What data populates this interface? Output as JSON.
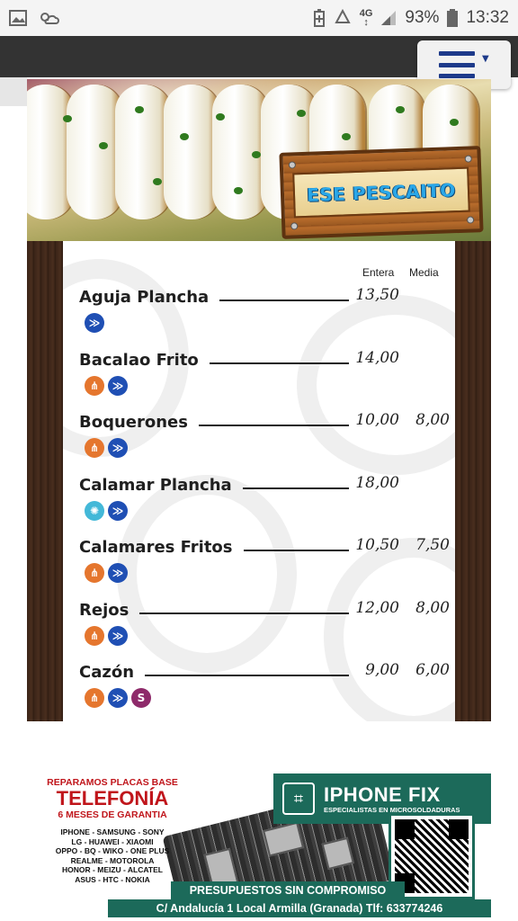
{
  "status_bar": {
    "network": "4G",
    "battery": "93%",
    "time": "13:32"
  },
  "header": {
    "menu_icon": "hamburger-icon",
    "accent_color": "#1d3a8a"
  },
  "hero": {
    "sign_text": "ESE PESCAITO"
  },
  "menu": {
    "col_entera": "Entera",
    "col_media": "Media",
    "items": [
      {
        "name": "Aguja Plancha",
        "entera": "13,50",
        "media": "",
        "allergens": [
          "fish"
        ]
      },
      {
        "name": "Bacalao Frito",
        "entera": "14,00",
        "media": "",
        "allergens": [
          "gluten",
          "fish"
        ]
      },
      {
        "name": "Boquerones",
        "entera": "10,00",
        "media": "8,00",
        "allergens": [
          "gluten",
          "fish"
        ]
      },
      {
        "name": "Calamar Plancha",
        "entera": "18,00",
        "media": "",
        "allergens": [
          "crustacean",
          "fish"
        ]
      },
      {
        "name": "Calamares Fritos",
        "entera": "10,50",
        "media": "7,50",
        "allergens": [
          "gluten",
          "fish"
        ]
      },
      {
        "name": "Rejos",
        "entera": "12,00",
        "media": "8,00",
        "allergens": [
          "gluten",
          "fish"
        ]
      },
      {
        "name": "Cazón",
        "entera": "9,00",
        "media": "6,00",
        "allergens": [
          "gluten",
          "fish",
          "sulphites"
        ]
      }
    ]
  },
  "ad": {
    "line1": "REPARAMOS PLACAS BASE",
    "line2": "TELEFONÍA",
    "line3": "6 MESES DE GARANTIA",
    "brands": [
      "IPHONE - SAMSUNG - SONY",
      "LG - HUAWEI - XIAOMI",
      "OPPO - BQ - WIKO - ONE PLUS",
      "REALME - MOTOROLA",
      "HONOR - MEIZU - ALCATEL",
      "ASUS - HTC - NOKIA"
    ],
    "brand_name": "IPHONE FIX",
    "brand_tagline": "ESPECIALISTAS EN MICROSOLDADURAS",
    "qr_label": "IPHONE FIX",
    "bottom1": "PRESUPUESTOS SIN COMPROMISO",
    "bottom2": "C/ Andalucía 1 Local Armilla (Granada) Tlf: 633774246",
    "brand_color": "#1c6a5a"
  }
}
